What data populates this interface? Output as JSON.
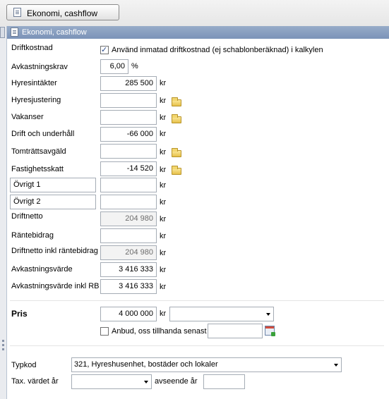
{
  "tab": {
    "label": "Ekonomi, cashflow"
  },
  "section": {
    "title": "Ekonomi, cashflow"
  },
  "driftkostnad": {
    "label": "Driftkostnad",
    "checkbox_label": "Använd inmatad driftkostnad (ej schablonberäknad) i kalkylen",
    "checked": true
  },
  "avkastningskrav": {
    "label": "Avkastningskrav",
    "value": "6,00",
    "unit": "%"
  },
  "rows": [
    {
      "label": "Hyresintäkter",
      "value": "285 500",
      "unit": "kr"
    },
    {
      "label": "Hyresjustering",
      "value": "",
      "unit": "kr"
    },
    {
      "label": "Vakanser",
      "value": "",
      "unit": "kr"
    },
    {
      "label": "Drift och underhåll",
      "value": "-66 000",
      "unit": "kr"
    },
    {
      "label": "Tomträttsavgäld",
      "value": "",
      "unit": "kr"
    },
    {
      "label": "Fastighetsskatt",
      "value": "-14 520",
      "unit": "kr"
    },
    {
      "label": "Övrigt 1",
      "value": "",
      "unit": "kr"
    },
    {
      "label": "Övrigt 2",
      "value": "",
      "unit": "kr"
    },
    {
      "label": "Driftnetto",
      "value": "204 980",
      "unit": "kr"
    },
    {
      "label": "Räntebidrag",
      "value": "",
      "unit": "kr"
    },
    {
      "label": "Driftnetto inkl räntebidrag",
      "value": "204 980",
      "unit": "kr"
    },
    {
      "label": "Avkastningsvärde",
      "value": "3 416 333",
      "unit": "kr"
    },
    {
      "label": "Avkastningsvärde inkl RB",
      "value": "3 416 333",
      "unit": "kr"
    }
  ],
  "pris": {
    "label": "Pris",
    "value": "4 000 000",
    "unit": "kr",
    "dropdown_value": ""
  },
  "anbud": {
    "label": "Anbud, oss tillhanda senast",
    "checked": false,
    "date_value": ""
  },
  "typkod": {
    "label": "Typkod",
    "value": "321, Hyreshusenhet, bostäder och lokaler"
  },
  "tax": {
    "label": "Tax. värdet år",
    "year_value": "",
    "avseende_label": "avseende år",
    "avseende_value": ""
  },
  "icons": {
    "folder": "folder-icon",
    "calendar": "calendar-icon",
    "document": "document-icon"
  }
}
